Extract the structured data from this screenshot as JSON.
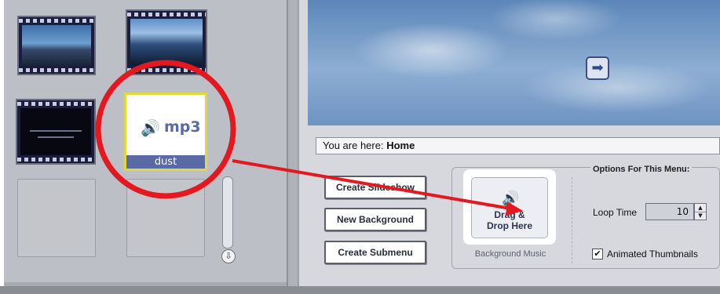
{
  "media_panel": {
    "mp3_thumb": {
      "badge": "mp3",
      "caption": "dust",
      "icon": "speaker-icon"
    }
  },
  "preview": {
    "next_icon": "arrow-right-icon"
  },
  "breadcrumb": {
    "prefix": "You are here:",
    "location": "Home"
  },
  "buttons": {
    "create_slideshow": "Create Slideshow",
    "new_background": "New Background",
    "create_submenu": "Create Submenu"
  },
  "drop_zone": {
    "line1": "Drag &",
    "line2": "Drop Here",
    "label": "Background Music"
  },
  "options": {
    "title": "Options For This Menu:",
    "loop_time_label": "Loop Time",
    "loop_time_value": "10",
    "animated_thumbnails_label": "Animated Thumbnails",
    "animated_thumbnails_checked": true
  },
  "colors": {
    "annotation": "#e3191f",
    "accent": "#5a6aa4",
    "selection": "#e1d83b"
  }
}
